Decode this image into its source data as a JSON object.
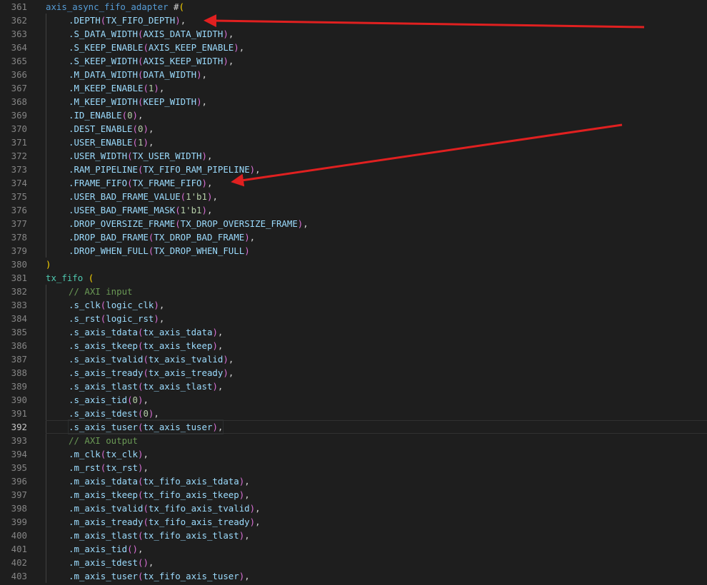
{
  "editor": {
    "current_line": 392,
    "lines": [
      {
        "n": "361",
        "indent": 0,
        "tokens": [
          [
            "axis_async_fifo_adapter",
            "t-ident"
          ],
          [
            " #",
            "t-plain"
          ],
          [
            "(",
            "t-b3"
          ]
        ]
      },
      {
        "n": "362",
        "indent": 1,
        "tokens": [
          [
            ".DEPTH",
            "t-port"
          ],
          [
            "(",
            "t-b1"
          ],
          [
            "TX_FIFO_DEPTH",
            "t-port"
          ],
          [
            ")",
            "t-b1"
          ],
          [
            ",",
            "t-plain"
          ]
        ]
      },
      {
        "n": "363",
        "indent": 1,
        "tokens": [
          [
            ".S_DATA_WIDTH",
            "t-port"
          ],
          [
            "(",
            "t-b1"
          ],
          [
            "AXIS_DATA_WIDTH",
            "t-port"
          ],
          [
            ")",
            "t-b1"
          ],
          [
            ",",
            "t-plain"
          ]
        ]
      },
      {
        "n": "364",
        "indent": 1,
        "tokens": [
          [
            ".S_KEEP_ENABLE",
            "t-port"
          ],
          [
            "(",
            "t-b1"
          ],
          [
            "AXIS_KEEP_ENABLE",
            "t-port"
          ],
          [
            ")",
            "t-b1"
          ],
          [
            ",",
            "t-plain"
          ]
        ]
      },
      {
        "n": "365",
        "indent": 1,
        "tokens": [
          [
            ".S_KEEP_WIDTH",
            "t-port"
          ],
          [
            "(",
            "t-b1"
          ],
          [
            "AXIS_KEEP_WIDTH",
            "t-port"
          ],
          [
            ")",
            "t-b1"
          ],
          [
            ",",
            "t-plain"
          ]
        ]
      },
      {
        "n": "366",
        "indent": 1,
        "tokens": [
          [
            ".M_DATA_WIDTH",
            "t-port"
          ],
          [
            "(",
            "t-b1"
          ],
          [
            "DATA_WIDTH",
            "t-port"
          ],
          [
            ")",
            "t-b1"
          ],
          [
            ",",
            "t-plain"
          ]
        ]
      },
      {
        "n": "367",
        "indent": 1,
        "tokens": [
          [
            ".M_KEEP_ENABLE",
            "t-port"
          ],
          [
            "(",
            "t-b1"
          ],
          [
            "1",
            "t-num"
          ],
          [
            ")",
            "t-b1"
          ],
          [
            ",",
            "t-plain"
          ]
        ]
      },
      {
        "n": "368",
        "indent": 1,
        "tokens": [
          [
            ".M_KEEP_WIDTH",
            "t-port"
          ],
          [
            "(",
            "t-b1"
          ],
          [
            "KEEP_WIDTH",
            "t-port"
          ],
          [
            ")",
            "t-b1"
          ],
          [
            ",",
            "t-plain"
          ]
        ]
      },
      {
        "n": "369",
        "indent": 1,
        "tokens": [
          [
            ".ID_ENABLE",
            "t-port"
          ],
          [
            "(",
            "t-b1"
          ],
          [
            "0",
            "t-num"
          ],
          [
            ")",
            "t-b1"
          ],
          [
            ",",
            "t-plain"
          ]
        ]
      },
      {
        "n": "370",
        "indent": 1,
        "tokens": [
          [
            ".DEST_ENABLE",
            "t-port"
          ],
          [
            "(",
            "t-b1"
          ],
          [
            "0",
            "t-num"
          ],
          [
            ")",
            "t-b1"
          ],
          [
            ",",
            "t-plain"
          ]
        ]
      },
      {
        "n": "371",
        "indent": 1,
        "tokens": [
          [
            ".USER_ENABLE",
            "t-port"
          ],
          [
            "(",
            "t-b1"
          ],
          [
            "1",
            "t-num"
          ],
          [
            ")",
            "t-b1"
          ],
          [
            ",",
            "t-plain"
          ]
        ]
      },
      {
        "n": "372",
        "indent": 1,
        "tokens": [
          [
            ".USER_WIDTH",
            "t-port"
          ],
          [
            "(",
            "t-b1"
          ],
          [
            "TX_USER_WIDTH",
            "t-port"
          ],
          [
            ")",
            "t-b1"
          ],
          [
            ",",
            "t-plain"
          ]
        ]
      },
      {
        "n": "373",
        "indent": 1,
        "tokens": [
          [
            ".RAM_PIPELINE",
            "t-port"
          ],
          [
            "(",
            "t-b1"
          ],
          [
            "TX_FIFO_RAM_PIPELINE",
            "t-port"
          ],
          [
            ")",
            "t-b1"
          ],
          [
            ",",
            "t-plain"
          ]
        ]
      },
      {
        "n": "374",
        "indent": 1,
        "tokens": [
          [
            ".FRAME_FIFO",
            "t-port"
          ],
          [
            "(",
            "t-b1"
          ],
          [
            "TX_FRAME_FIFO",
            "t-port"
          ],
          [
            ")",
            "t-b1"
          ],
          [
            ",",
            "t-plain"
          ]
        ]
      },
      {
        "n": "375",
        "indent": 1,
        "tokens": [
          [
            ".USER_BAD_FRAME_VALUE",
            "t-port"
          ],
          [
            "(",
            "t-b1"
          ],
          [
            "1'b1",
            "t-num"
          ],
          [
            ")",
            "t-b1"
          ],
          [
            ",",
            "t-plain"
          ]
        ]
      },
      {
        "n": "376",
        "indent": 1,
        "tokens": [
          [
            ".USER_BAD_FRAME_MASK",
            "t-port"
          ],
          [
            "(",
            "t-b1"
          ],
          [
            "1'b1",
            "t-num"
          ],
          [
            ")",
            "t-b1"
          ],
          [
            ",",
            "t-plain"
          ]
        ]
      },
      {
        "n": "377",
        "indent": 1,
        "tokens": [
          [
            ".DROP_OVERSIZE_FRAME",
            "t-port"
          ],
          [
            "(",
            "t-b1"
          ],
          [
            "TX_DROP_OVERSIZE_FRAME",
            "t-port"
          ],
          [
            ")",
            "t-b1"
          ],
          [
            ",",
            "t-plain"
          ]
        ]
      },
      {
        "n": "378",
        "indent": 1,
        "tokens": [
          [
            ".DROP_BAD_FRAME",
            "t-port"
          ],
          [
            "(",
            "t-b1"
          ],
          [
            "TX_DROP_BAD_FRAME",
            "t-port"
          ],
          [
            ")",
            "t-b1"
          ],
          [
            ",",
            "t-plain"
          ]
        ]
      },
      {
        "n": "379",
        "indent": 1,
        "tokens": [
          [
            ".DROP_WHEN_FULL",
            "t-port"
          ],
          [
            "(",
            "t-b1"
          ],
          [
            "TX_DROP_WHEN_FULL",
            "t-port"
          ],
          [
            ")",
            "t-b1"
          ]
        ]
      },
      {
        "n": "380",
        "indent": 0,
        "tokens": [
          [
            ")",
            "t-b3"
          ]
        ]
      },
      {
        "n": "381",
        "indent": 0,
        "tokens": [
          [
            "tx_fifo",
            "t-type"
          ],
          [
            " ",
            "t-plain"
          ],
          [
            "(",
            "t-b3"
          ]
        ]
      },
      {
        "n": "382",
        "indent": 1,
        "tokens": [
          [
            "// AXI input",
            "t-comment"
          ]
        ]
      },
      {
        "n": "383",
        "indent": 1,
        "tokens": [
          [
            ".s_clk",
            "t-port"
          ],
          [
            "(",
            "t-b1"
          ],
          [
            "logic_clk",
            "t-port"
          ],
          [
            ")",
            "t-b1"
          ],
          [
            ",",
            "t-plain"
          ]
        ]
      },
      {
        "n": "384",
        "indent": 1,
        "tokens": [
          [
            ".s_rst",
            "t-port"
          ],
          [
            "(",
            "t-b1"
          ],
          [
            "logic_rst",
            "t-port"
          ],
          [
            ")",
            "t-b1"
          ],
          [
            ",",
            "t-plain"
          ]
        ]
      },
      {
        "n": "385",
        "indent": 1,
        "tokens": [
          [
            ".s_axis_tdata",
            "t-port"
          ],
          [
            "(",
            "t-b1"
          ],
          [
            "tx_axis_tdata",
            "t-port"
          ],
          [
            ")",
            "t-b1"
          ],
          [
            ",",
            "t-plain"
          ]
        ]
      },
      {
        "n": "386",
        "indent": 1,
        "tokens": [
          [
            ".s_axis_tkeep",
            "t-port"
          ],
          [
            "(",
            "t-b1"
          ],
          [
            "tx_axis_tkeep",
            "t-port"
          ],
          [
            ")",
            "t-b1"
          ],
          [
            ",",
            "t-plain"
          ]
        ]
      },
      {
        "n": "387",
        "indent": 1,
        "tokens": [
          [
            ".s_axis_tvalid",
            "t-port"
          ],
          [
            "(",
            "t-b1"
          ],
          [
            "tx_axis_tvalid",
            "t-port"
          ],
          [
            ")",
            "t-b1"
          ],
          [
            ",",
            "t-plain"
          ]
        ]
      },
      {
        "n": "388",
        "indent": 1,
        "tokens": [
          [
            ".s_axis_tready",
            "t-port"
          ],
          [
            "(",
            "t-b1"
          ],
          [
            "tx_axis_tready",
            "t-port"
          ],
          [
            ")",
            "t-b1"
          ],
          [
            ",",
            "t-plain"
          ]
        ]
      },
      {
        "n": "389",
        "indent": 1,
        "tokens": [
          [
            ".s_axis_tlast",
            "t-port"
          ],
          [
            "(",
            "t-b1"
          ],
          [
            "tx_axis_tlast",
            "t-port"
          ],
          [
            ")",
            "t-b1"
          ],
          [
            ",",
            "t-plain"
          ]
        ]
      },
      {
        "n": "390",
        "indent": 1,
        "tokens": [
          [
            ".s_axis_tid",
            "t-port"
          ],
          [
            "(",
            "t-b1"
          ],
          [
            "0",
            "t-num"
          ],
          [
            ")",
            "t-b1"
          ],
          [
            ",",
            "t-plain"
          ]
        ]
      },
      {
        "n": "391",
        "indent": 1,
        "tokens": [
          [
            ".s_axis_tdest",
            "t-port"
          ],
          [
            "(",
            "t-b1"
          ],
          [
            "0",
            "t-num"
          ],
          [
            ")",
            "t-b1"
          ],
          [
            ",",
            "t-plain"
          ]
        ]
      },
      {
        "n": "392",
        "indent": 1,
        "tokens": [
          [
            ".s_axis_tuser",
            "t-port"
          ],
          [
            "(",
            "t-b1"
          ],
          [
            "tx_axis_tuser",
            "t-port"
          ],
          [
            ")",
            "t-b1"
          ],
          [
            ",",
            "t-plain"
          ]
        ]
      },
      {
        "n": "393",
        "indent": 1,
        "tokens": [
          [
            "// AXI output",
            "t-comment"
          ]
        ]
      },
      {
        "n": "394",
        "indent": 1,
        "tokens": [
          [
            ".m_clk",
            "t-port"
          ],
          [
            "(",
            "t-b1"
          ],
          [
            "tx_clk",
            "t-port"
          ],
          [
            ")",
            "t-b1"
          ],
          [
            ",",
            "t-plain"
          ]
        ]
      },
      {
        "n": "395",
        "indent": 1,
        "tokens": [
          [
            ".m_rst",
            "t-port"
          ],
          [
            "(",
            "t-b1"
          ],
          [
            "tx_rst",
            "t-port"
          ],
          [
            ")",
            "t-b1"
          ],
          [
            ",",
            "t-plain"
          ]
        ]
      },
      {
        "n": "396",
        "indent": 1,
        "tokens": [
          [
            ".m_axis_tdata",
            "t-port"
          ],
          [
            "(",
            "t-b1"
          ],
          [
            "tx_fifo_axis_tdata",
            "t-port"
          ],
          [
            ")",
            "t-b1"
          ],
          [
            ",",
            "t-plain"
          ]
        ]
      },
      {
        "n": "397",
        "indent": 1,
        "tokens": [
          [
            ".m_axis_tkeep",
            "t-port"
          ],
          [
            "(",
            "t-b1"
          ],
          [
            "tx_fifo_axis_tkeep",
            "t-port"
          ],
          [
            ")",
            "t-b1"
          ],
          [
            ",",
            "t-plain"
          ]
        ]
      },
      {
        "n": "398",
        "indent": 1,
        "tokens": [
          [
            ".m_axis_tvalid",
            "t-port"
          ],
          [
            "(",
            "t-b1"
          ],
          [
            "tx_fifo_axis_tvalid",
            "t-port"
          ],
          [
            ")",
            "t-b1"
          ],
          [
            ",",
            "t-plain"
          ]
        ]
      },
      {
        "n": "399",
        "indent": 1,
        "tokens": [
          [
            ".m_axis_tready",
            "t-port"
          ],
          [
            "(",
            "t-b1"
          ],
          [
            "tx_fifo_axis_tready",
            "t-port"
          ],
          [
            ")",
            "t-b1"
          ],
          [
            ",",
            "t-plain"
          ]
        ]
      },
      {
        "n": "400",
        "indent": 1,
        "tokens": [
          [
            ".m_axis_tlast",
            "t-port"
          ],
          [
            "(",
            "t-b1"
          ],
          [
            "tx_fifo_axis_tlast",
            "t-port"
          ],
          [
            ")",
            "t-b1"
          ],
          [
            ",",
            "t-plain"
          ]
        ]
      },
      {
        "n": "401",
        "indent": 1,
        "tokens": [
          [
            ".m_axis_tid",
            "t-port"
          ],
          [
            "(",
            "t-b1"
          ],
          [
            ")",
            "t-b1"
          ],
          [
            ",",
            "t-plain"
          ]
        ]
      },
      {
        "n": "402",
        "indent": 1,
        "tokens": [
          [
            ".m_axis_tdest",
            "t-port"
          ],
          [
            "(",
            "t-b1"
          ],
          [
            ")",
            "t-b1"
          ],
          [
            ",",
            "t-plain"
          ]
        ]
      },
      {
        "n": "403",
        "indent": 1,
        "tokens": [
          [
            ".m_axis_tuser",
            "t-port"
          ],
          [
            "(",
            "t-b1"
          ],
          [
            "tx_fifo_axis_tuser",
            "t-port"
          ],
          [
            ")",
            "t-b1"
          ],
          [
            ",",
            "t-plain"
          ]
        ]
      }
    ]
  },
  "annotations": {
    "arrow_color": "#e02020",
    "arrows": [
      {
        "points_to_line": 362
      },
      {
        "points_to_line": 374
      }
    ]
  }
}
